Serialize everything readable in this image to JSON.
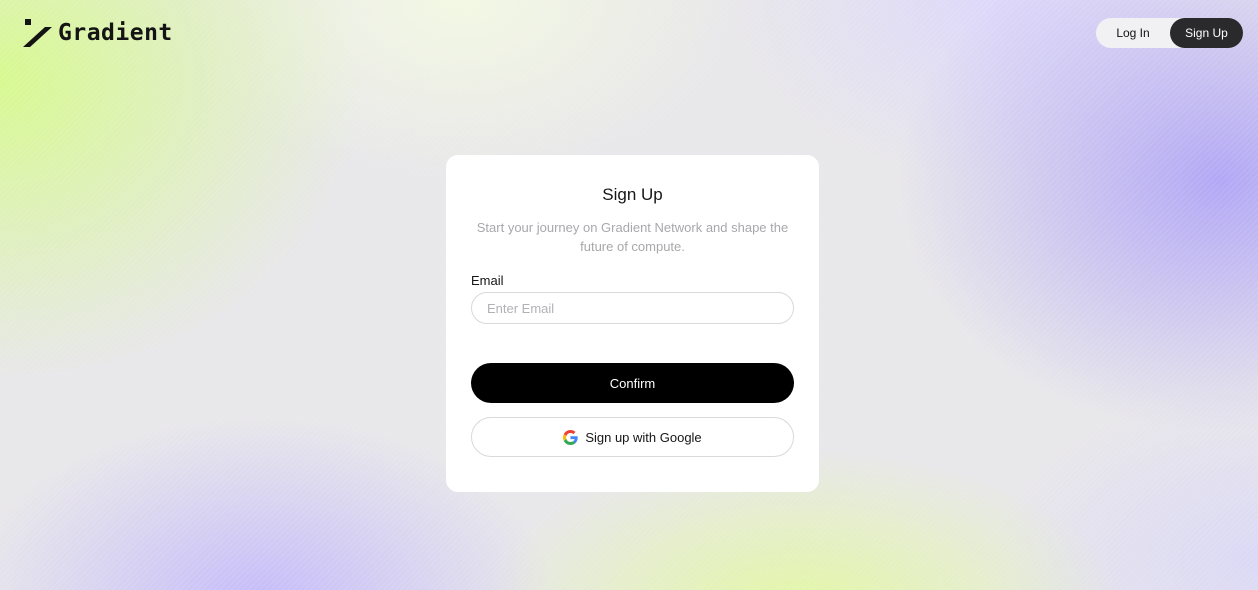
{
  "brand": {
    "name": "Gradient",
    "logo_icon": "gradient-logo-icon"
  },
  "header": {
    "login_label": "Log In",
    "signup_label": "Sign Up",
    "active": "Sign Up"
  },
  "signup_card": {
    "title": "Sign Up",
    "subtitle": "Start your journey on Gradient Network and shape the future of compute.",
    "email_label": "Email",
    "email_placeholder": "Enter Email",
    "email_value": "",
    "confirm_label": "Confirm",
    "google_label": "Sign up with Google",
    "google_icon": "google-icon"
  },
  "colors": {
    "primary_button": "#000000",
    "active_toggle": "#2a2a2c",
    "accent_green": "#d6fa8c",
    "accent_purple": "#b0a4f6"
  }
}
